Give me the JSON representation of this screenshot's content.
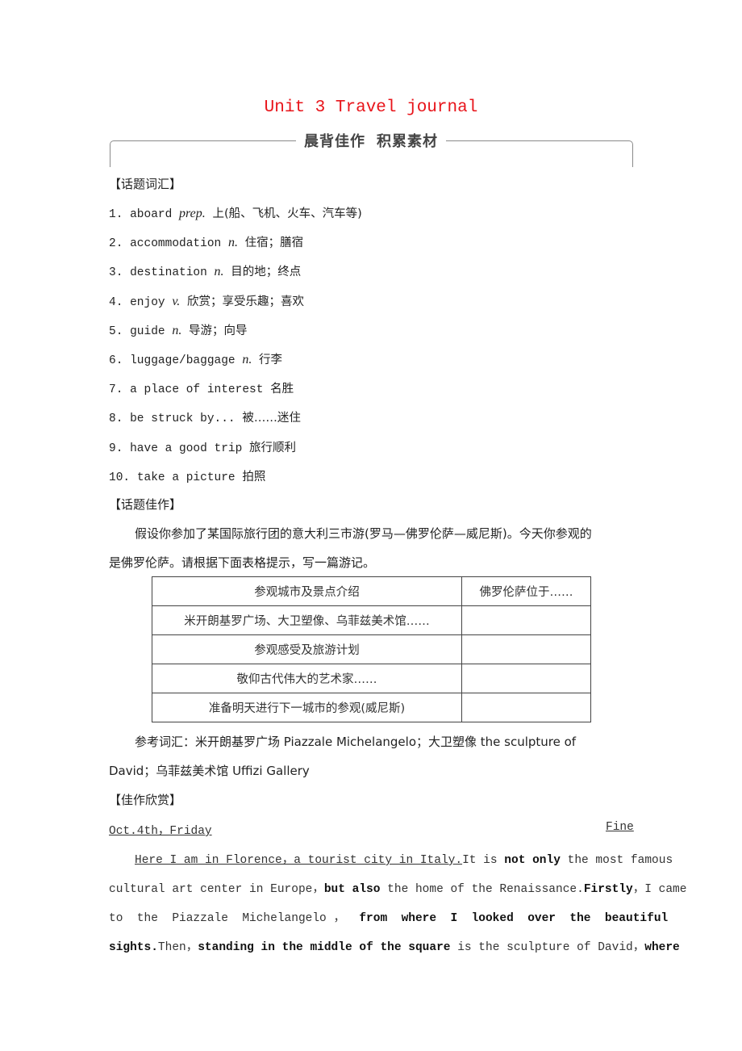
{
  "header": {
    "title": "Unit 3 Travel journal",
    "banner_left": "晨背佳作",
    "banner_right": "积累素材"
  },
  "vocab_section": {
    "heading": "【话题词汇】",
    "items": [
      {
        "num": "1.",
        "term": "aboard",
        "pos": "prep.",
        "meaning": "上(船、飞机、火车、汽车等)"
      },
      {
        "num": "2.",
        "term": "accommodation",
        "pos": "n.",
        "meaning": "住宿；膳宿"
      },
      {
        "num": "3.",
        "term": "destination",
        "pos": "n.",
        "meaning": "目的地；终点"
      },
      {
        "num": "4.",
        "term": "enjoy",
        "pos": "v.",
        "meaning": "欣赏；享受乐趣；喜欢"
      },
      {
        "num": "5.",
        "term": "guide",
        "pos": "n.",
        "meaning": "导游；向导"
      },
      {
        "num": "6.",
        "term": "luggage/baggage",
        "pos": "n.",
        "meaning": "行李"
      },
      {
        "num": "7.",
        "term": "a place of interest",
        "pos": "",
        "meaning": "名胜"
      },
      {
        "num": "8.",
        "term": "be struck by...",
        "pos": "",
        "meaning": "被……迷住"
      },
      {
        "num": "9.",
        "term": "have a good trip",
        "pos": "",
        "meaning": "旅行顺利"
      },
      {
        "num": "10.",
        "term": "take a picture",
        "pos": "",
        "meaning": "拍照"
      }
    ]
  },
  "writing_section": {
    "heading": "【话题佳作】",
    "prompt_line1": "假设你参加了某国际旅行团的意大利三市游(罗马—佛罗伦萨—威尼斯)。今天你参观的",
    "prompt_line2": "是佛罗伦萨。请根据下面表格提示，写一篇游记。",
    "table": {
      "rows": [
        [
          "参观城市及景点介绍",
          "佛罗伦萨位于……"
        ],
        [
          "米开朗基罗广场、大卫塑像、乌菲兹美术馆……",
          ""
        ],
        [
          "参观感受及旅游计划",
          ""
        ],
        [
          "敬仰古代伟大的艺术家……",
          ""
        ],
        [
          "准备明天进行下一城市的参观(威尼斯)",
          ""
        ]
      ]
    },
    "reference_line1": "参考词汇：米开朗基罗广场 Piazzale Michelangelo；大卫塑像 the sculpture of",
    "reference_line2": "David；乌菲兹美术馆 Uffizi Gallery"
  },
  "sample_section": {
    "heading": "【佳作欣赏】",
    "date": "Oct.4th，Friday",
    "weather": "Fine",
    "essay": {
      "l1_underlined": "Here I am in Florence，a tourist city in Italy.",
      "l1_a": "It is ",
      "l1_b_bold": "not only",
      "l1_c": " the most famous",
      "l2_a": "cultural art center in Europe，",
      "l2_b_bold": "but also",
      "l2_c": " the home of the Renaissance.",
      "l2_d_bold": "Firstly",
      "l2_e": "，I came",
      "l3_a": "to  the  Piazzale  Michelangelo ，",
      "l3_b_bold": "  from  where  I  looked  over  the  beautiful",
      "l4_a_bold": "sights.",
      "l4_b": "Then，",
      "l4_c_bold": "standing in the middle of the square",
      "l4_d": " is the sculpture of David，",
      "l4_e_bold": "where"
    }
  }
}
